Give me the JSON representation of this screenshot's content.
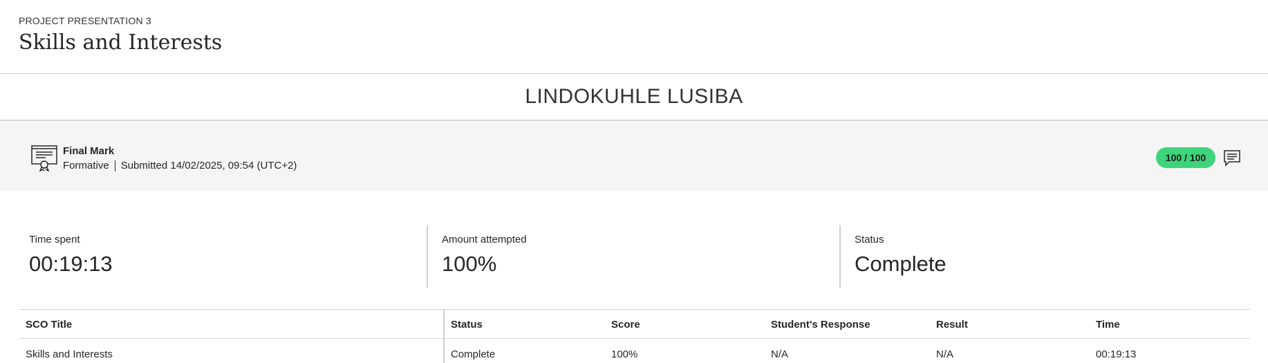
{
  "header": {
    "overline": "PROJECT PRESENTATION 3",
    "title": "Skills and Interests",
    "accent_color": "#c866d6"
  },
  "student": {
    "name": "LINDOKUHLE LUSIBA"
  },
  "grade": {
    "icon": "certificate-icon",
    "title": "Final Mark",
    "category": "Formative",
    "submitted": "Submitted 14/02/2025, 09:54 (UTC+2)",
    "score": "100 / 100",
    "score_color": "#3ed47a",
    "feedback_icon": "feedback-comment-icon"
  },
  "stats": [
    {
      "label": "Time spent",
      "value": "00:19:13"
    },
    {
      "label": "Amount attempted",
      "value": "100%"
    },
    {
      "label": "Status",
      "value": "Complete"
    }
  ],
  "table": {
    "headers": [
      "SCO Title",
      "Status",
      "Score",
      "Student's Response",
      "Result",
      "Time"
    ],
    "rows": [
      [
        "Skills and Interests",
        "Complete",
        "100%",
        "N/A",
        "N/A",
        "00:19:13"
      ]
    ]
  }
}
